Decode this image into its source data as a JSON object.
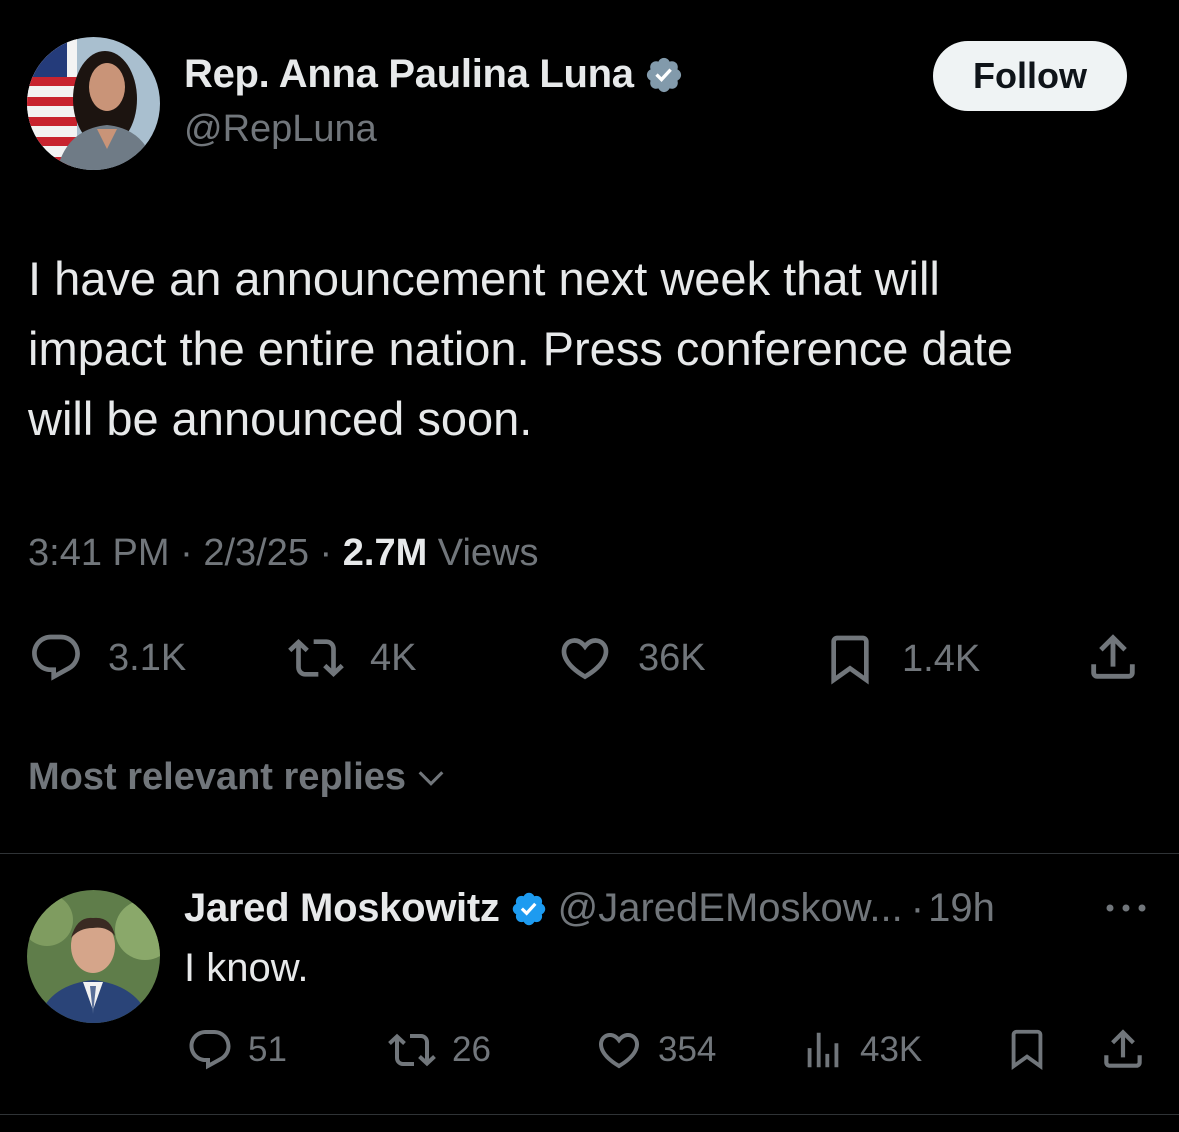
{
  "tweet": {
    "author": {
      "name": "Rep. Anna Paulina Luna",
      "handle": "@RepLuna",
      "verified": true,
      "badge_color": "#829aab",
      "avatar": "avatar-photo"
    },
    "follow_label": "Follow",
    "text": "I have an announcement next week that will\nimpact the entire nation. Press conference date\nwill be announced soon.",
    "time": "3:41 PM",
    "date": "2/3/25",
    "separator": "·",
    "views_count": "2.7M",
    "views_label": "Views",
    "stats": {
      "replies": "3.1K",
      "reposts": "4K",
      "likes": "36K",
      "bookmarks": "1.4K"
    },
    "icons": [
      "reply-icon",
      "repost-icon",
      "like-icon",
      "bookmark-icon",
      "share-icon"
    ]
  },
  "replies_sort": {
    "label": "Most relevant replies",
    "icon": "chevron-down-icon"
  },
  "reply": {
    "author": {
      "name": "Jared Moskowitz",
      "handle": "@JaredEMoskow...",
      "verified": true,
      "badge_color": "#1d9bf0",
      "avatar": "avatar-photo"
    },
    "separator": "·",
    "time": "19h",
    "text": "I know.",
    "stats": {
      "replies": "51",
      "reposts": "26",
      "likes": "354",
      "views": "43K"
    },
    "icons": [
      "more-icon",
      "reply-icon",
      "repost-icon",
      "like-icon",
      "views-icon",
      "bookmark-icon",
      "share-icon"
    ]
  },
  "colors": {
    "background": "#000000",
    "text_primary": "#e7e9ea",
    "text_secondary": "#71767b",
    "divider": "#2f3336",
    "follow_button_bg": "#eff3f4"
  }
}
